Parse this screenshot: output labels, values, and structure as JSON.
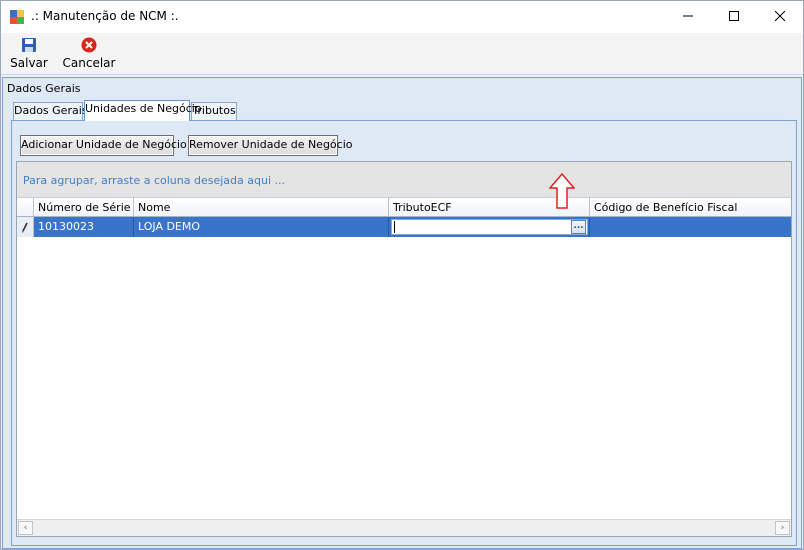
{
  "window": {
    "title": ".: Manutenção de NCM :.",
    "controls": {
      "minimize": "minimize-icon",
      "maximize": "maximize-icon",
      "close": "close-icon"
    }
  },
  "toolbar": {
    "save_label": "Salvar",
    "cancel_label": "Cancelar",
    "save_icon": "floppy-disk-icon",
    "cancel_icon": "red-x-circle-icon"
  },
  "group": {
    "label": "Dados Gerais"
  },
  "tabs": [
    {
      "label": "Dados Gerais",
      "active": false
    },
    {
      "label": "Unidades de Negócio",
      "active": true
    },
    {
      "label": "Tributos",
      "active": false
    }
  ],
  "actions": {
    "add_label": "Adicionar Unidade de Negócio",
    "remove_label": "Remover Unidade de Negócio"
  },
  "grid": {
    "group_hint": "Para agrupar, arraste a coluna desejada aqui ...",
    "columns": [
      "Número de Série",
      "Nome",
      "TributoECF",
      "Código de Benefício Fiscal"
    ],
    "rows": [
      {
        "numero_serie": "10130023",
        "nome": "LOJA DEMO",
        "tributo_ecf": "",
        "codigo_beneficio": ""
      }
    ],
    "editor_button": "...",
    "selection_color": "#3a74c9"
  },
  "annotation": {
    "arrow_color": "#e0201c",
    "direction": "up"
  }
}
